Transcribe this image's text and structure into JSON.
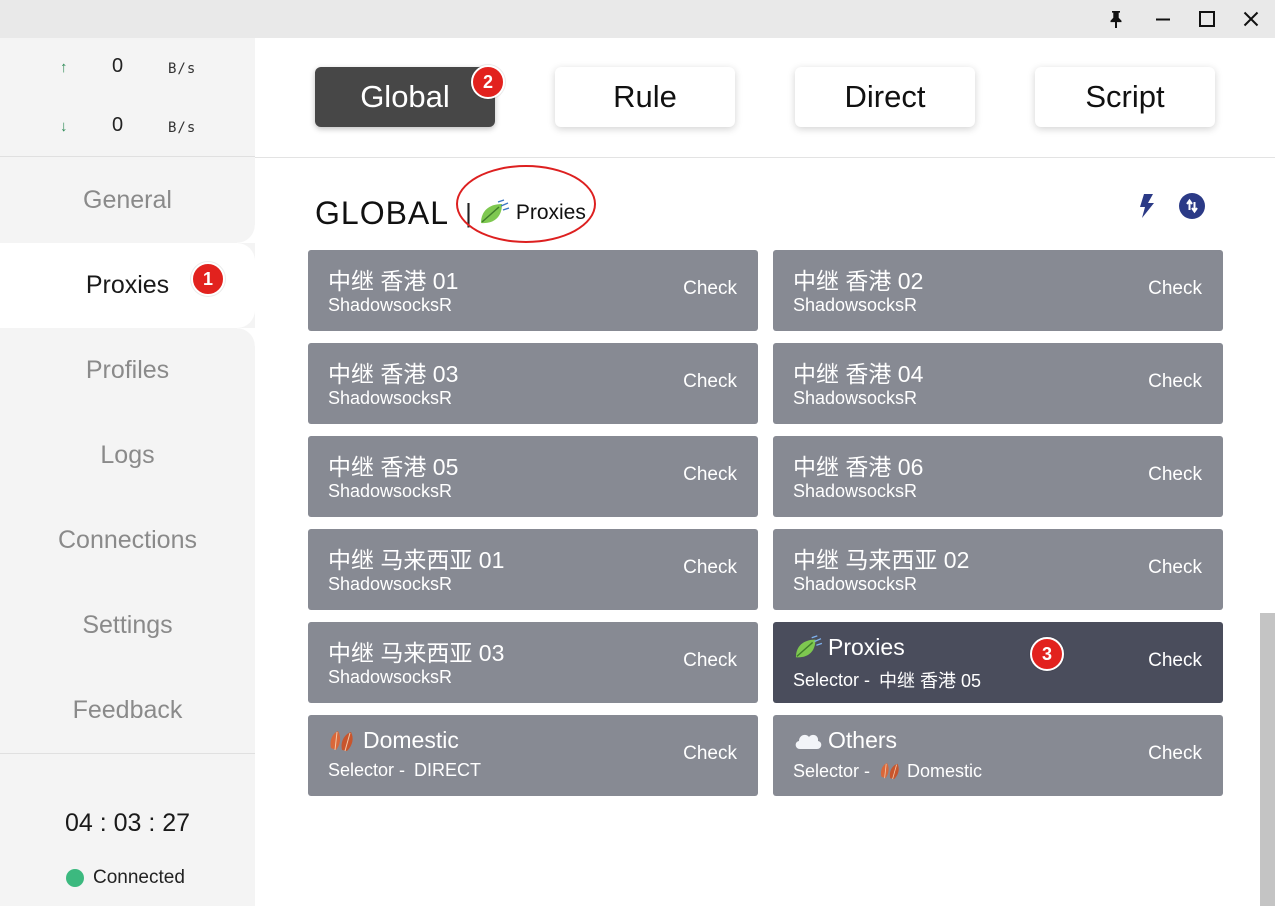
{
  "window": {
    "pin_icon": "pin-icon",
    "minimize_icon": "minimize-icon",
    "maximize_icon": "maximize-icon",
    "close_icon": "close-icon"
  },
  "traffic": {
    "up_arrow": "↑",
    "up_value": "0",
    "up_unit": "B/s",
    "down_arrow": "↓",
    "down_value": "0",
    "down_unit": "B/s"
  },
  "nav": {
    "items": [
      {
        "label": "General"
      },
      {
        "label": "Proxies"
      },
      {
        "label": "Profiles"
      },
      {
        "label": "Logs"
      },
      {
        "label": "Connections"
      },
      {
        "label": "Settings"
      },
      {
        "label": "Feedback"
      }
    ],
    "active_index": 1
  },
  "status": {
    "timer": "04 : 03 : 27",
    "connection": "Connected",
    "connection_color": "#3cb97f"
  },
  "modes": {
    "items": [
      {
        "label": "Global"
      },
      {
        "label": "Rule"
      },
      {
        "label": "Direct"
      },
      {
        "label": "Script"
      }
    ],
    "active_index": 0,
    "active_color": "#474747"
  },
  "group": {
    "title": "GLOBAL",
    "separator": "|",
    "selected": "Proxies",
    "selected_icon": "leaf-icon"
  },
  "toolbar": {
    "speedtest_icon": "lightning-icon",
    "refresh_icon": "sync-icon"
  },
  "annotations": [
    "1",
    "2",
    "3"
  ],
  "proxies": [
    {
      "name": "中继 香港 01",
      "type": "ShadowsocksR",
      "action": "Check"
    },
    {
      "name": "中继 香港 02",
      "type": "ShadowsocksR",
      "action": "Check"
    },
    {
      "name": "中继 香港 03",
      "type": "ShadowsocksR",
      "action": "Check"
    },
    {
      "name": "中继 香港 04",
      "type": "ShadowsocksR",
      "action": "Check"
    },
    {
      "name": "中继 香港 05",
      "type": "ShadowsocksR",
      "action": "Check"
    },
    {
      "name": "中继 香港 06",
      "type": "ShadowsocksR",
      "action": "Check"
    },
    {
      "name": "中继 马来西亚 01",
      "type": "ShadowsocksR",
      "action": "Check"
    },
    {
      "name": "中继 马来西亚 02",
      "type": "ShadowsocksR",
      "action": "Check"
    },
    {
      "name": "中继 马来西亚 03",
      "type": "ShadowsocksR",
      "action": "Check"
    },
    {
      "name": "Proxies",
      "type_prefix": "Selector - ",
      "type": "中继 香港 05",
      "action": "Check",
      "selected": true
    },
    {
      "name": "Domestic",
      "type_prefix": "Selector - ",
      "type": "DIRECT",
      "action": "Check"
    },
    {
      "name": "Others",
      "type_prefix": "Selector - ",
      "type": "Domestic",
      "action": "Check"
    }
  ],
  "colors": {
    "card": "#878a93",
    "card_selected": "#4a4d5c",
    "badge": "#e2221e"
  }
}
